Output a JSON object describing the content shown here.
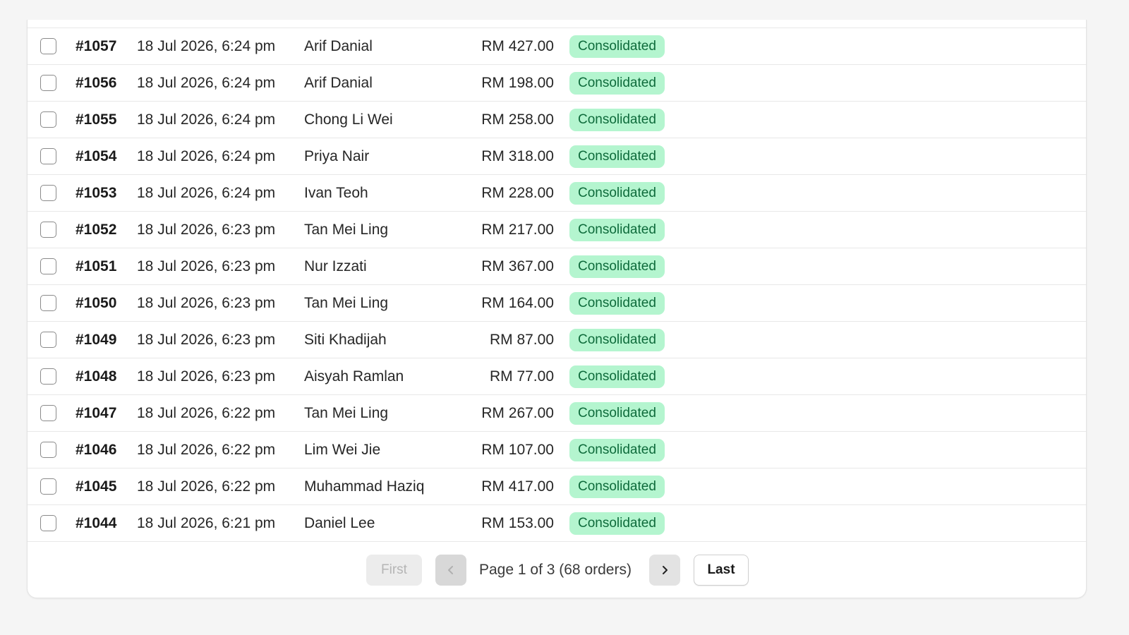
{
  "orders": [
    {
      "id": "#1057",
      "date": "18 Jul 2026, 6:24 pm",
      "customer": "Arif Danial",
      "amount": "RM 427.00",
      "status": "Consolidated"
    },
    {
      "id": "#1056",
      "date": "18 Jul 2026, 6:24 pm",
      "customer": "Arif Danial",
      "amount": "RM 198.00",
      "status": "Consolidated"
    },
    {
      "id": "#1055",
      "date": "18 Jul 2026, 6:24 pm",
      "customer": "Chong Li Wei",
      "amount": "RM 258.00",
      "status": "Consolidated"
    },
    {
      "id": "#1054",
      "date": "18 Jul 2026, 6:24 pm",
      "customer": "Priya Nair",
      "amount": "RM 318.00",
      "status": "Consolidated"
    },
    {
      "id": "#1053",
      "date": "18 Jul 2026, 6:24 pm",
      "customer": "Ivan Teoh",
      "amount": "RM 228.00",
      "status": "Consolidated"
    },
    {
      "id": "#1052",
      "date": "18 Jul 2026, 6:23 pm",
      "customer": "Tan Mei Ling",
      "amount": "RM 217.00",
      "status": "Consolidated"
    },
    {
      "id": "#1051",
      "date": "18 Jul 2026, 6:23 pm",
      "customer": "Nur Izzati",
      "amount": "RM 367.00",
      "status": "Consolidated"
    },
    {
      "id": "#1050",
      "date": "18 Jul 2026, 6:23 pm",
      "customer": "Tan Mei Ling",
      "amount": "RM 164.00",
      "status": "Consolidated"
    },
    {
      "id": "#1049",
      "date": "18 Jul 2026, 6:23 pm",
      "customer": "Siti Khadijah",
      "amount": "RM 87.00",
      "status": "Consolidated"
    },
    {
      "id": "#1048",
      "date": "18 Jul 2026, 6:23 pm",
      "customer": "Aisyah Ramlan",
      "amount": "RM 77.00",
      "status": "Consolidated"
    },
    {
      "id": "#1047",
      "date": "18 Jul 2026, 6:22 pm",
      "customer": "Tan Mei Ling",
      "amount": "RM 267.00",
      "status": "Consolidated"
    },
    {
      "id": "#1046",
      "date": "18 Jul 2026, 6:22 pm",
      "customer": "Lim Wei Jie",
      "amount": "RM 107.00",
      "status": "Consolidated"
    },
    {
      "id": "#1045",
      "date": "18 Jul 2026, 6:22 pm",
      "customer": "Muhammad Haziq",
      "amount": "RM 417.00",
      "status": "Consolidated"
    },
    {
      "id": "#1044",
      "date": "18 Jul 2026, 6:21 pm",
      "customer": "Daniel Lee",
      "amount": "RM 153.00",
      "status": "Consolidated"
    }
  ],
  "pagination": {
    "first_label": "First",
    "prev_icon": "chevron-left-icon",
    "page_info": "Page 1 of 3 (68 orders)",
    "next_icon": "chevron-right-icon",
    "last_label": "Last",
    "current_page": 1,
    "total_pages": 3,
    "first_disabled": true,
    "prev_disabled": true
  },
  "colors": {
    "badge_bg": "#b4f5cf",
    "badge_text": "#0e6b3b",
    "page_bg": "#f5f5f5",
    "card_bg": "#ffffff"
  }
}
